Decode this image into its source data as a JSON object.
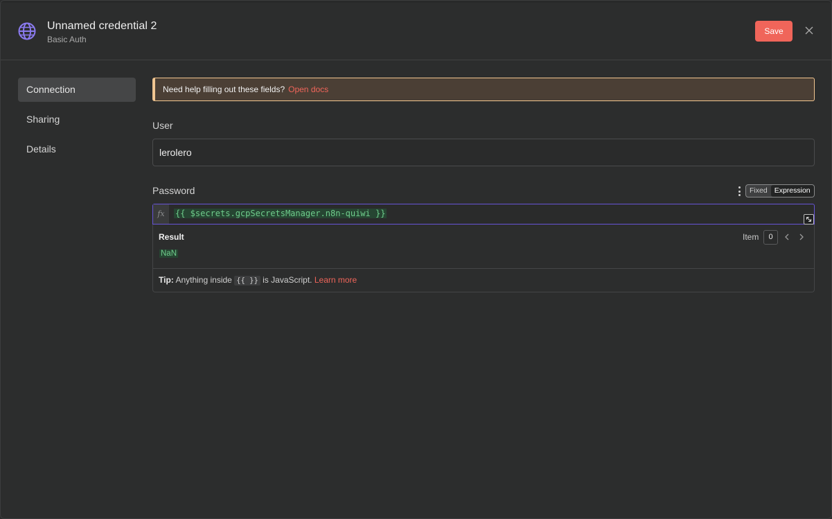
{
  "header": {
    "title": "Unnamed credential 2",
    "subtitle": "Basic Auth",
    "save_label": "Save",
    "icon": "globe-icon",
    "accent_color": "#8b7bf0"
  },
  "sidebar": {
    "items": [
      {
        "label": "Connection",
        "active": true
      },
      {
        "label": "Sharing",
        "active": false
      },
      {
        "label": "Details",
        "active": false
      }
    ]
  },
  "notice": {
    "text": "Need help filling out these fields?",
    "link": "Open docs"
  },
  "user": {
    "label": "User",
    "value": "lerolero"
  },
  "password": {
    "label": "Password",
    "mode_options": [
      "Fixed",
      "Expression"
    ],
    "active_mode": "Expression",
    "fx_label": "fx",
    "expression": "{{  $secrets.gcpSecretsManager.n8n-quiwi }}"
  },
  "result": {
    "title": "Result",
    "item_label": "Item",
    "item_index": "0",
    "value": "NaN"
  },
  "tip": {
    "strong": "Tip:",
    "before": "Anything inside",
    "code": "{{ }}",
    "after": "is JavaScript.",
    "link": "Learn more"
  }
}
